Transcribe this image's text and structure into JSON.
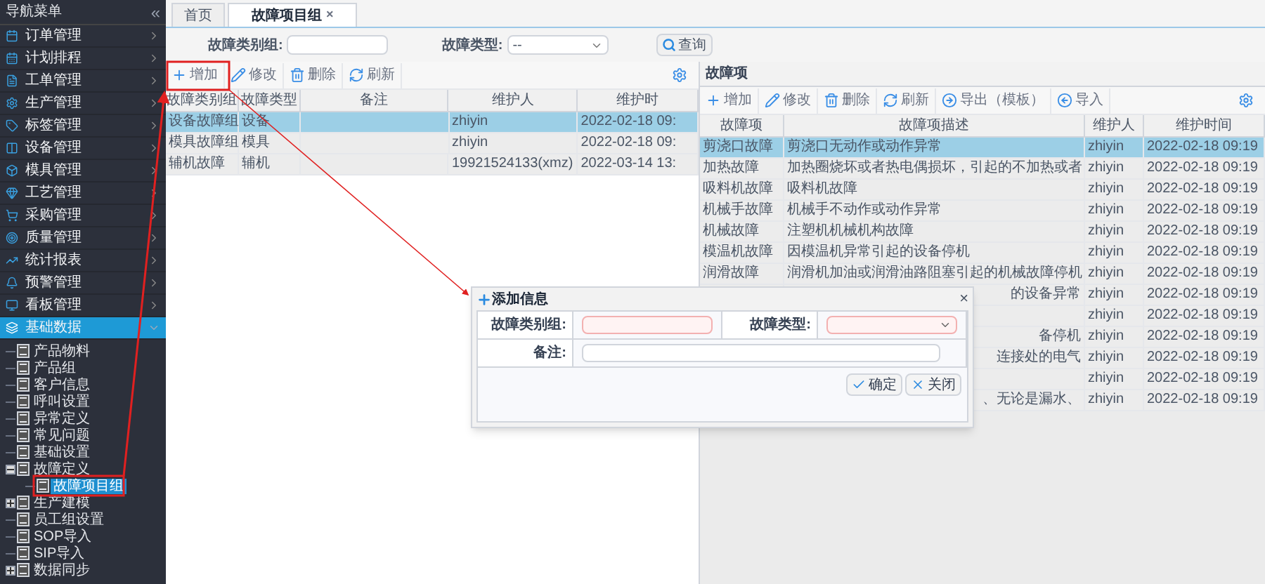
{
  "sidebar": {
    "title": "导航菜单",
    "collapse_glyph": "«",
    "items": [
      {
        "label": "订单管理",
        "expanded": false
      },
      {
        "label": "计划排程",
        "expanded": false
      },
      {
        "label": "工单管理",
        "expanded": false
      },
      {
        "label": "生产管理",
        "expanded": false
      },
      {
        "label": "标签管理",
        "expanded": false
      },
      {
        "label": "设备管理",
        "expanded": false
      },
      {
        "label": "模具管理",
        "expanded": false
      },
      {
        "label": "工艺管理",
        "expanded": false
      },
      {
        "label": "采购管理",
        "expanded": false
      },
      {
        "label": "质量管理",
        "expanded": false
      },
      {
        "label": "统计报表",
        "expanded": false
      },
      {
        "label": "预警管理",
        "expanded": false
      },
      {
        "label": "看板管理",
        "expanded": false
      },
      {
        "label": "基础数据",
        "expanded": true,
        "children": [
          {
            "label": "产品物料",
            "kind": "leaf",
            "selected": false
          },
          {
            "label": "产品组",
            "kind": "leaf",
            "selected": false
          },
          {
            "label": "客户信息",
            "kind": "leaf",
            "selected": false
          },
          {
            "label": "呼叫设置",
            "kind": "leaf",
            "selected": false
          },
          {
            "label": "异常定义",
            "kind": "leaf",
            "selected": false
          },
          {
            "label": "常见问题",
            "kind": "leaf",
            "selected": false
          },
          {
            "label": "基础设置",
            "kind": "leaf",
            "selected": false
          },
          {
            "label": "故障定义",
            "kind": "folder",
            "expanded": true,
            "selected": false,
            "children": [
              {
                "label": "故障项目组",
                "kind": "leaf",
                "selected": true
              }
            ]
          },
          {
            "label": "生产建模",
            "kind": "folder",
            "expanded": false,
            "selected": false
          },
          {
            "label": "员工组设置",
            "kind": "leaf",
            "selected": false
          },
          {
            "label": "SOP导入",
            "kind": "leaf",
            "selected": false
          },
          {
            "label": "SIP导入",
            "kind": "leaf",
            "selected": false
          },
          {
            "label": "数据同步",
            "kind": "folder",
            "expanded": false,
            "selected": false
          }
        ]
      }
    ]
  },
  "tabs": [
    {
      "label": "首页",
      "selected": false
    },
    {
      "label": "故障项目组",
      "selected": true,
      "close": "×"
    }
  ],
  "search": {
    "group_label": "故障类别组:",
    "type_label": "故障类型:",
    "type_value": "--",
    "button": "查询"
  },
  "left_panel": {
    "toolbar": [
      "增加",
      "修改",
      "删除",
      "刷新"
    ],
    "columns": [
      "故障类别组",
      "故障类型",
      "备注",
      "维护人",
      "维护时"
    ],
    "rows": [
      {
        "cells": [
          "设备故障组",
          "设备",
          "",
          "zhiyin",
          "2022-02-18 09:"
        ],
        "selected": true
      },
      {
        "cells": [
          "模具故障组",
          "模具",
          "",
          "zhiyin",
          "2022-02-18 09:"
        ],
        "selected": false
      },
      {
        "cells": [
          "辅机故障",
          "辅机",
          "",
          "19921524133(xmz)",
          "2022-03-14 13:"
        ],
        "selected": false
      }
    ]
  },
  "right_panel": {
    "title": "故障项",
    "toolbar": [
      "增加",
      "修改",
      "删除",
      "刷新",
      "导出（模板）",
      "导入"
    ],
    "columns": [
      "故障项",
      "故障项描述",
      "维护人",
      "维护时间"
    ],
    "rows": [
      {
        "cells": [
          "剪浇口故障",
          "剪浇口无动作或动作异常",
          "zhiyin",
          "2022-02-18 09:19"
        ],
        "selected": true
      },
      {
        "cells": [
          "加热故障",
          "加热圈烧坏或者热电偶损坏，引起的不加热或者",
          "zhiyin",
          "2022-02-18 09:19"
        ],
        "selected": false
      },
      {
        "cells": [
          "吸料机故障",
          "吸料机故障",
          "zhiyin",
          "2022-02-18 09:19"
        ],
        "selected": false
      },
      {
        "cells": [
          "机械手故障",
          "机械手不动作或动作异常",
          "zhiyin",
          "2022-02-18 09:19"
        ],
        "selected": false
      },
      {
        "cells": [
          "机械故障",
          "注塑机机械机构故障",
          "zhiyin",
          "2022-02-18 09:19"
        ],
        "selected": false
      },
      {
        "cells": [
          "模温机故障",
          "因模温机异常引起的设备停机",
          "zhiyin",
          "2022-02-18 09:19"
        ],
        "selected": false
      },
      {
        "cells": [
          "润滑故障",
          "润滑机加油或润滑油路阻塞引起的机械故障停机",
          "zhiyin",
          "2022-02-18 09:19"
        ],
        "selected": false
      },
      {
        "cells": [
          "",
          "的设备异常",
          "zhiyin",
          "2022-02-18 09:19"
        ],
        "selected": false
      },
      {
        "cells": [
          "",
          "",
          "zhiyin",
          "2022-02-18 09:19"
        ],
        "selected": false
      },
      {
        "cells": [
          "",
          "备停机",
          "zhiyin",
          "2022-02-18 09:19"
        ],
        "selected": false
      },
      {
        "cells": [
          "",
          "连接处的电气",
          "zhiyin",
          "2022-02-18 09:19"
        ],
        "selected": false
      },
      {
        "cells": [
          "",
          "",
          "zhiyin",
          "2022-02-18 09:19"
        ],
        "selected": false
      },
      {
        "cells": [
          "",
          "、无论是漏水、",
          "zhiyin",
          "2022-02-18 09:19"
        ],
        "selected": false
      }
    ]
  },
  "dialog": {
    "title": "添加信息",
    "close": "×",
    "fields": [
      {
        "label": "故障类别组:",
        "kind": "input",
        "required": true
      },
      {
        "label": "故障类型:",
        "kind": "select",
        "required": true
      },
      {
        "label": "备注:",
        "kind": "input",
        "required": false
      }
    ],
    "buttons": [
      "确定",
      "关闭"
    ]
  }
}
